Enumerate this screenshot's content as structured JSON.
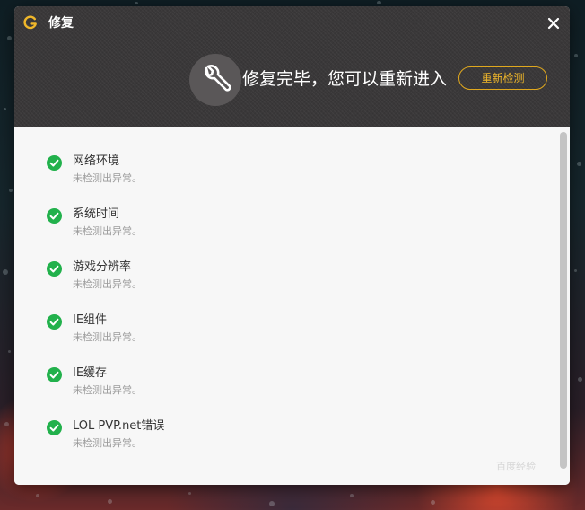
{
  "window": {
    "title": "修复",
    "close_icon": "close-icon"
  },
  "header": {
    "status_text": "修复完毕，您可以重新进入",
    "status_icon": "wrench-icon",
    "recheck_label": "重新检测",
    "accent_color": "#f0b72a"
  },
  "items": [
    {
      "title": "网络环境",
      "status": "未检测出异常。"
    },
    {
      "title": "系统时间",
      "status": "未检测出异常。"
    },
    {
      "title": "游戏分辨率",
      "status": "未检测出异常。"
    },
    {
      "title": "IE组件",
      "status": "未检测出异常。"
    },
    {
      "title": "IE缓存",
      "status": "未检测出异常。"
    },
    {
      "title": "LOL PVP.net错误",
      "status": "未检测出异常。"
    }
  ],
  "check_color": "#22b14c",
  "watermark": "百度经验"
}
